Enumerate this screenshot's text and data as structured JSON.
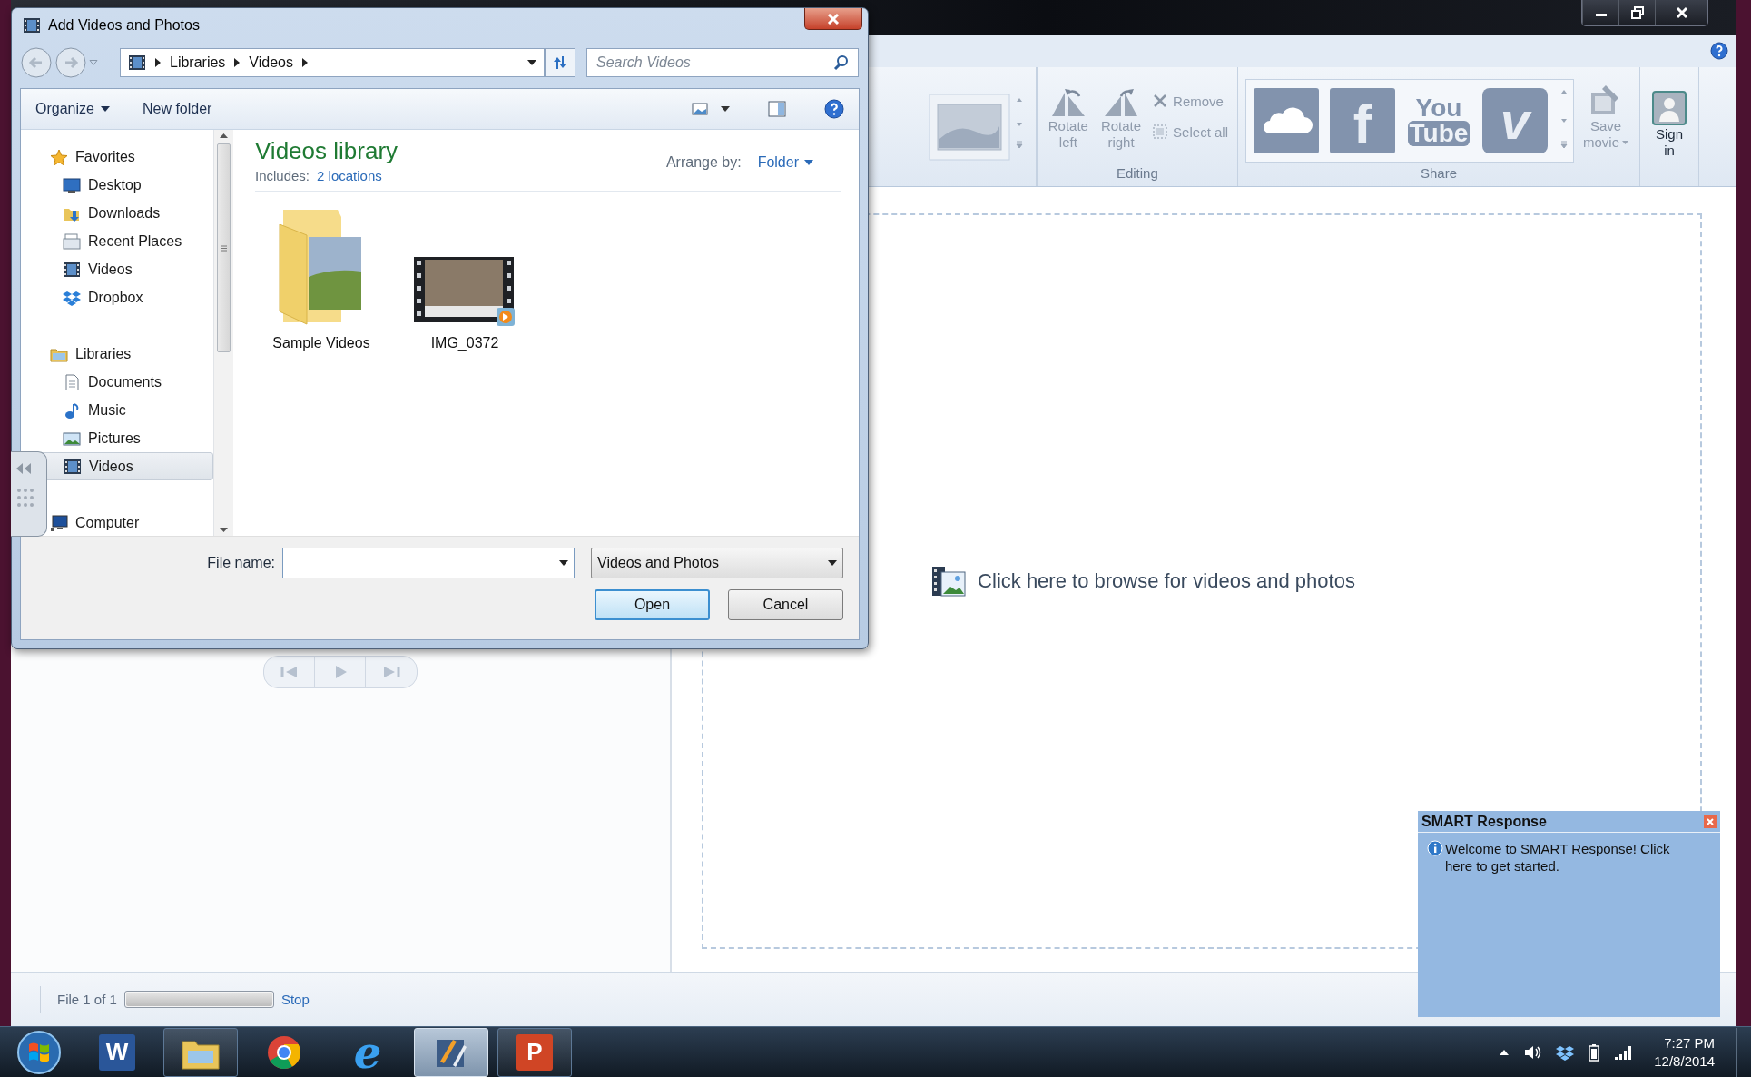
{
  "app_window": {
    "ribbon": {
      "editing": {
        "label": "Editing",
        "big_buttons": [
          {
            "kind": "rotate_left",
            "lines": [
              "Rotate",
              "left"
            ],
            "disabled": true
          },
          {
            "kind": "rotate_right",
            "lines": [
              "Rotate",
              "right"
            ],
            "disabled": true
          }
        ],
        "small_buttons": [
          {
            "kind": "remove",
            "label": "Remove",
            "disabled": true
          },
          {
            "kind": "select_all",
            "label": "Select all",
            "disabled": true
          }
        ]
      },
      "share": {
        "label": "Share",
        "services": [
          {
            "kind": "cloud"
          },
          {
            "kind": "facebook",
            "lines": [
              "f"
            ]
          },
          {
            "kind": "youtube",
            "lines": [
              "You",
              "Tube"
            ]
          },
          {
            "kind": "vimeo",
            "lines": [
              "v"
            ]
          }
        ],
        "save_movie": {
          "lines": [
            "Save",
            "movie"
          ],
          "disabled": true
        }
      },
      "sign_in": {
        "lines": [
          "Sign",
          "in"
        ],
        "disabled": false
      }
    },
    "storyboard": {
      "prompt": "Click here to browse for videos and photos"
    },
    "status_bar": {
      "file_text": "File 1 of 1",
      "progress": {
        "level": 1
      },
      "stop": "Stop"
    }
  },
  "dialog": {
    "title": "Add Videos and Photos",
    "breadcrumb": [
      "Libraries",
      "Videos"
    ],
    "search": {
      "placeholder": "Search Videos"
    },
    "toolbar": {
      "organize": "Organize",
      "new_folder": "New folder"
    },
    "tree": [
      {
        "label": "Favorites",
        "kind": "favorites",
        "selected": false,
        "children": [
          {
            "label": "Desktop",
            "kind": "desktop",
            "selected": false
          },
          {
            "label": "Downloads",
            "kind": "downloads",
            "selected": false
          },
          {
            "label": "Recent Places",
            "kind": "recent",
            "selected": false
          },
          {
            "label": "Videos",
            "kind": "videos",
            "selected": false
          },
          {
            "label": "Dropbox",
            "kind": "dropbox",
            "selected": false
          }
        ]
      },
      {
        "label": "Libraries",
        "kind": "libraries",
        "selected": false,
        "children": [
          {
            "label": "Documents",
            "kind": "documents",
            "selected": false
          },
          {
            "label": "Music",
            "kind": "music",
            "selected": false
          },
          {
            "label": "Pictures",
            "kind": "pictures",
            "selected": false
          },
          {
            "label": "Videos",
            "kind": "videos",
            "selected": true
          }
        ]
      },
      {
        "label": "Computer",
        "kind": "computer",
        "selected": false
      }
    ],
    "library": {
      "title": "Videos library",
      "includes_label": "Includes:",
      "includes_link": "2 locations",
      "arrange_label": "Arrange by:",
      "arrange_value": "Folder"
    },
    "items": [
      {
        "name": "Sample Videos",
        "kind": "folder"
      },
      {
        "name": "IMG_0372",
        "kind": "video"
      }
    ],
    "file_name_label": "File name:",
    "file_type": "Videos and Photos",
    "buttons": [
      {
        "label": "Open",
        "default": true
      },
      {
        "label": "Cancel",
        "default": false
      }
    ]
  },
  "notification": {
    "title": "SMART Response",
    "message": "Welcome to SMART Response! Click here to get started."
  },
  "taskbar": {
    "apps": [
      {
        "kind": "word",
        "text": "W",
        "running": false,
        "active": false
      },
      {
        "kind": "explorer",
        "running": true,
        "active": false
      },
      {
        "kind": "chrome",
        "running": false,
        "active": false
      },
      {
        "kind": "ie",
        "text": "e",
        "running": false,
        "active": false
      },
      {
        "kind": "moviemaker",
        "running": true,
        "active": true
      },
      {
        "kind": "powerpoint",
        "text": "P",
        "running": true,
        "active": false
      }
    ],
    "time": "7:27 PM",
    "date": "12/8/2014"
  }
}
